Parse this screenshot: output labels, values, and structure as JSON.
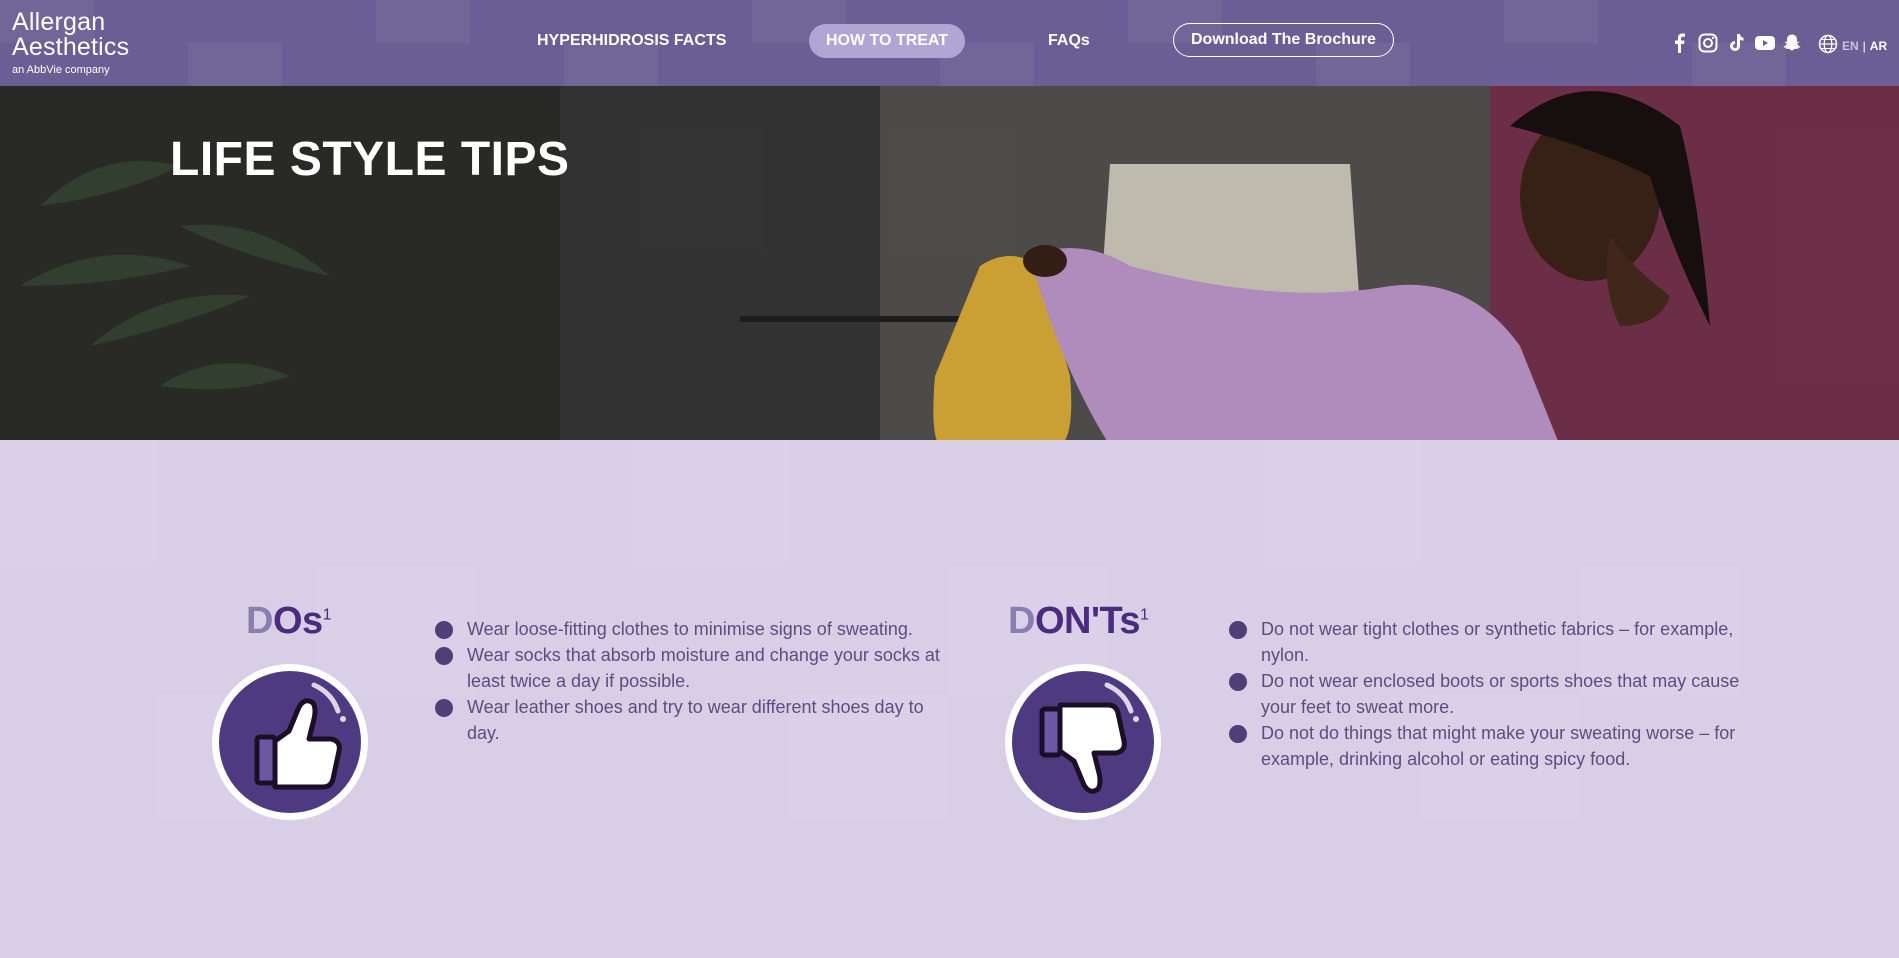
{
  "brand": {
    "line1": "Allergan",
    "line2": "Aesthetics",
    "tagline": "an AbbVie company"
  },
  "nav": {
    "items": [
      {
        "label": "HYPERHIDROSIS FACTS"
      },
      {
        "label": "HOW TO TREAT",
        "active": true
      },
      {
        "label": "FAQs"
      },
      {
        "label": "Download The Brochure"
      }
    ]
  },
  "social_icons": [
    "facebook-icon",
    "instagram-icon",
    "tiktok-icon",
    "youtube-icon",
    "snapchat-icon"
  ],
  "language": {
    "current": "EN",
    "separator": "|",
    "other": "AR"
  },
  "hero": {
    "title": "LIFE STYLE TIPS"
  },
  "dos": {
    "title_first": "D",
    "title_rest": "Os",
    "superscript": "1",
    "icon": "thumbs-up-icon",
    "items": [
      "Wear loose-fitting clothes to minimise signs of sweating.",
      "Wear socks that absorb moisture and change your socks at least twice a day if possible.",
      "Wear leather shoes and try to wear different shoes day to day."
    ]
  },
  "donts": {
    "title_first": "D",
    "title_rest": "ON'Ts",
    "superscript": "1",
    "icon": "thumbs-down-icon",
    "items": [
      "Do not wear tight clothes or synthetic fabrics – for example, nylon.",
      "Do not wear enclosed boots or sports shoes that may cause your feet to sweat more.",
      "Do not do things that might make your sweating worse – for example, drinking alcohol or eating spicy food."
    ]
  },
  "colors": {
    "header": "#6b5e94",
    "active_pill": "#b1a5d6",
    "content_bg": "#d8cfe7",
    "title_purple": "#4a2b7e",
    "bullet": "#4e3f78",
    "text": "#5b4d80"
  }
}
